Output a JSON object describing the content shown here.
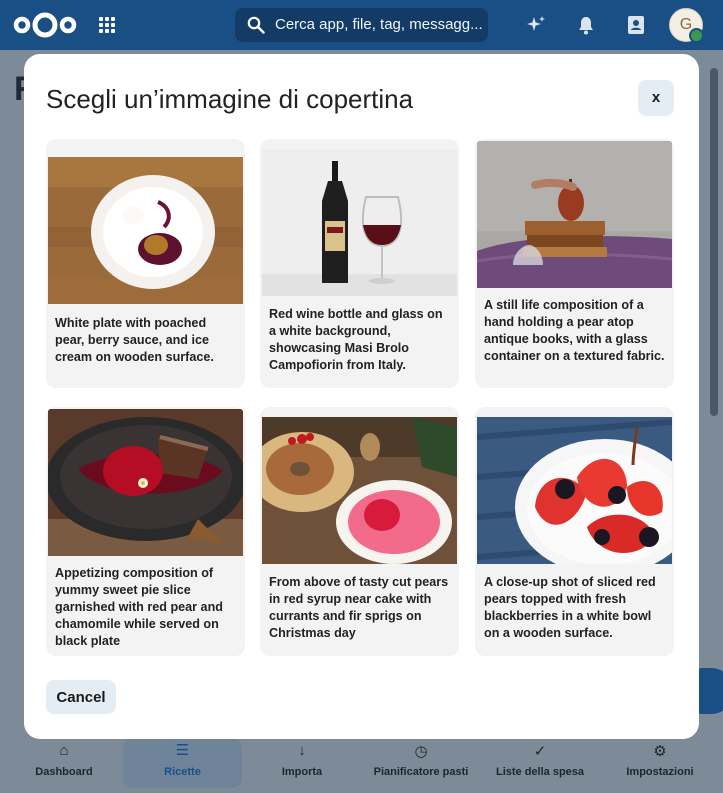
{
  "header": {
    "search_placeholder": "Cerca app, file, tag, messagg...",
    "avatar_initial": "G"
  },
  "page": {
    "title_initial": "R"
  },
  "modal": {
    "title": "Scegli un’immagine di copertina",
    "close_label": "x",
    "cancel_label": "Cancel",
    "images": [
      {
        "caption": "White plate with poached pear, berry sauce, and ice cream on wooden surface."
      },
      {
        "caption": "Red wine bottle and glass on a white background, showcasing Masi Brolo Campofiorin from Italy."
      },
      {
        "caption": "A still life composition of a hand holding a pear atop antique books, with a glass container on a textured fabric."
      },
      {
        "caption": "Appetizing composition of yummy sweet pie slice garnished with red pear and chamomile while served on black plate"
      },
      {
        "caption": "From above of tasty cut pears in red syrup near cake with currants and fir sprigs on Christmas day"
      },
      {
        "caption": "A close-up shot of sliced red pears topped with fresh blackberries in a white bowl on a wooden surface."
      }
    ]
  },
  "bottom_nav": {
    "items": [
      {
        "label": "Dashboard",
        "icon": "home-icon"
      },
      {
        "label": "Ricette",
        "icon": "list-icon"
      },
      {
        "label": "Importa",
        "icon": "import-icon"
      },
      {
        "label": "Pianificatore pasti",
        "icon": "clock-icon"
      },
      {
        "label": "Liste della spesa",
        "icon": "check-icon"
      },
      {
        "label": "Impostazioni",
        "icon": "gear-icon"
      }
    ],
    "active": "Ricette"
  },
  "colors": {
    "header": "#1a4f86",
    "overlay": "#7d8a97",
    "modal": "#ffffff",
    "card": "#f3f3f3",
    "button": "#e4ecf4"
  }
}
